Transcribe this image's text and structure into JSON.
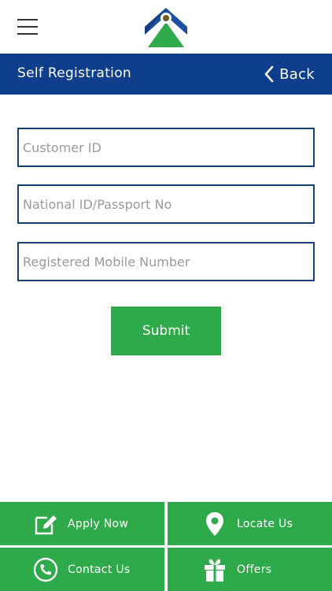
{
  "header": {
    "menu_icon": "hamburger-menu-icon",
    "logo": "bank-logo"
  },
  "titlebar": {
    "title": "Self Registration",
    "back_label": "Back",
    "back_icon": "chevron-left-icon"
  },
  "form": {
    "customer_id": {
      "placeholder": "Customer ID",
      "value": ""
    },
    "national_id": {
      "placeholder": "National ID/Passport No",
      "value": ""
    },
    "mobile": {
      "placeholder": "Registered Mobile Number",
      "value": ""
    },
    "submit_label": "Submit"
  },
  "bottom_nav": {
    "apply": {
      "label": "Apply Now",
      "icon": "edit-icon"
    },
    "locate": {
      "label": "Locate Us",
      "icon": "location-pin-icon"
    },
    "contact": {
      "label": "Contact Us",
      "icon": "phone-icon"
    },
    "offers": {
      "label": "Offers",
      "icon": "gift-icon"
    }
  },
  "colors": {
    "header_blue": "#0f3f8c",
    "brand_green": "#2faa4a",
    "field_border": "#163f7a"
  }
}
